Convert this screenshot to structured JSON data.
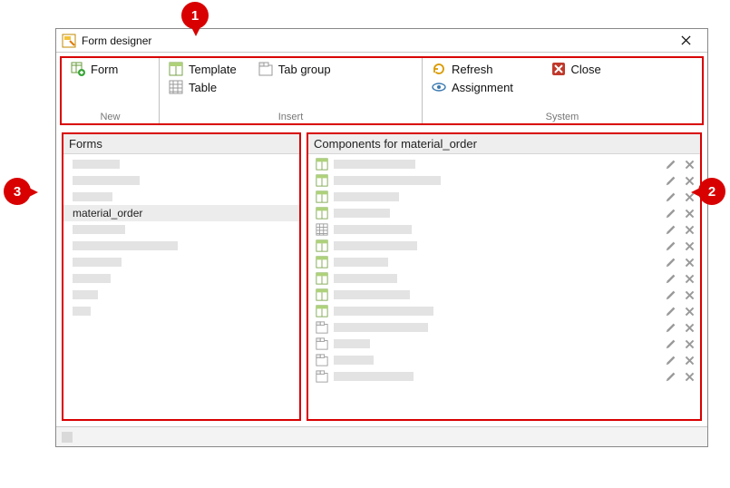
{
  "window": {
    "title": "Form designer"
  },
  "ribbon": {
    "groups": [
      {
        "label": "New",
        "items": [
          {
            "icon": "form-add-icon",
            "label": "Form"
          }
        ]
      },
      {
        "label": "Insert",
        "items": [
          {
            "icon": "template-icon",
            "label": "Template"
          },
          {
            "icon": "tabgroup-icon",
            "label": "Tab group"
          },
          {
            "icon": "table-icon",
            "label": "Table"
          }
        ]
      },
      {
        "label": "System",
        "items": [
          {
            "icon": "refresh-icon",
            "label": "Refresh"
          },
          {
            "icon": "close-red-icon",
            "label": "Close"
          },
          {
            "icon": "eye-icon",
            "label": "Assignment"
          }
        ]
      }
    ]
  },
  "forms_panel": {
    "header": "Forms",
    "items": [
      {
        "placeholder_width": 52
      },
      {
        "placeholder_width": 74
      },
      {
        "placeholder_width": 44
      },
      {
        "label": "material_order",
        "selected": true
      },
      {
        "placeholder_width": 58
      },
      {
        "placeholder_width": 116
      },
      {
        "placeholder_width": 54
      },
      {
        "placeholder_width": 42
      },
      {
        "placeholder_width": 28
      },
      {
        "placeholder_width": 20
      }
    ]
  },
  "components_panel": {
    "header": "Components for material_order",
    "items": [
      {
        "icon": "template-icon",
        "placeholder_width": 90
      },
      {
        "icon": "template-icon",
        "placeholder_width": 118
      },
      {
        "icon": "template-icon",
        "placeholder_width": 72
      },
      {
        "icon": "template-icon",
        "placeholder_width": 62
      },
      {
        "icon": "table-icon",
        "placeholder_width": 86
      },
      {
        "icon": "template-icon",
        "placeholder_width": 92
      },
      {
        "icon": "template-icon",
        "placeholder_width": 60
      },
      {
        "icon": "template-icon",
        "placeholder_width": 70
      },
      {
        "icon": "template-icon",
        "placeholder_width": 84
      },
      {
        "icon": "template-icon",
        "placeholder_width": 110
      },
      {
        "icon": "tabgroup-icon",
        "placeholder_width": 104
      },
      {
        "icon": "tabgroup-icon",
        "placeholder_width": 40
      },
      {
        "icon": "tabgroup-icon",
        "placeholder_width": 44
      },
      {
        "icon": "tabgroup-icon",
        "placeholder_width": 88
      }
    ]
  },
  "annotations": {
    "pin1": "1",
    "pin2": "2",
    "pin3": "3"
  },
  "colors": {
    "annotation": "#d80000"
  }
}
